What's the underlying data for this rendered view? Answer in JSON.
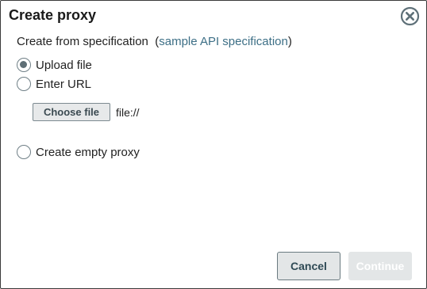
{
  "dialog": {
    "title": "Create proxy",
    "close_icon": "close-circle-icon"
  },
  "spec": {
    "label": "Create from specification",
    "paren_open": "(",
    "link_text": "sample API specification",
    "paren_close": ")"
  },
  "options": {
    "upload": {
      "label": "Upload file",
      "selected": true
    },
    "url": {
      "label": "Enter URL",
      "selected": false
    },
    "empty": {
      "label": "Create empty proxy",
      "selected": false
    }
  },
  "file": {
    "choose_label": "Choose file",
    "value": "file://"
  },
  "footer": {
    "cancel_label": "Cancel",
    "continue_label": "Continue",
    "continue_enabled": false
  },
  "colors": {
    "accent_link": "#3d6f86",
    "radio_fill": "#5e6e75",
    "button_bg": "#e3e6e7"
  }
}
